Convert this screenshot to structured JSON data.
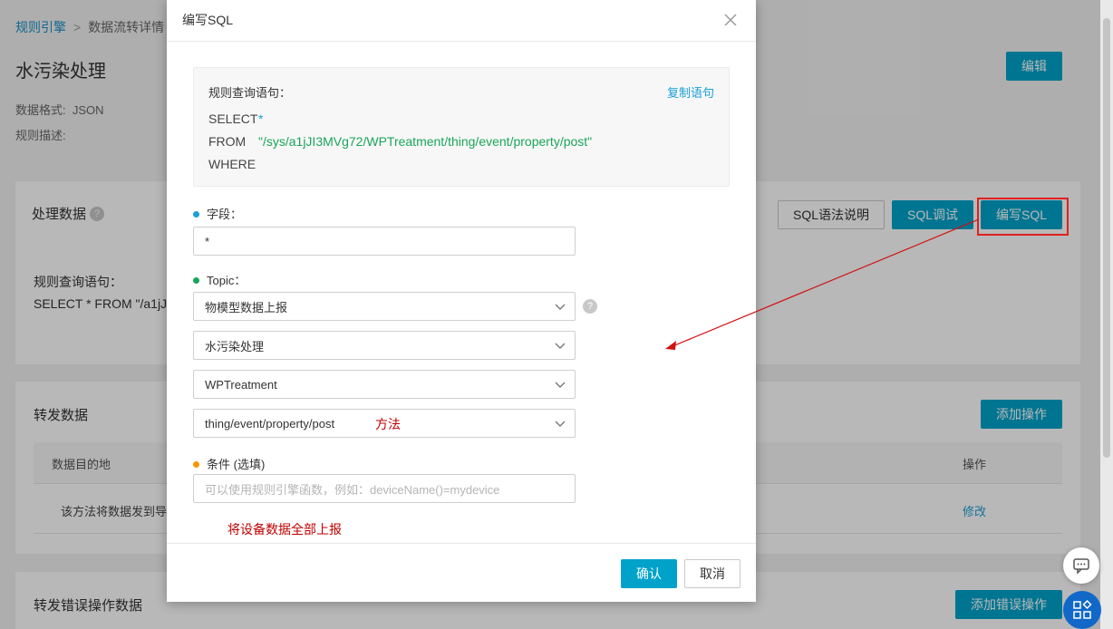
{
  "breadcrumb": {
    "root": "规则引擎",
    "current": "数据流转详情"
  },
  "page": {
    "title": "水污染处理",
    "data_format_label": "数据格式:",
    "data_format_value": "JSON",
    "desc_label": "规则描述:",
    "edit_button": "编辑"
  },
  "process_card": {
    "title": "处理数据",
    "help_glyph": "?",
    "sql_help_button": "SQL语法说明",
    "sql_debug_button": "SQL调试",
    "write_sql_button": "编写SQL",
    "query_label": "规则查询语句：",
    "query_value": "SELECT * FROM \"/a1jJ"
  },
  "forward_card": {
    "title": "转发数据",
    "add_button": "添加操作",
    "col_target": "数据目的地",
    "col_action": "操作",
    "row_target": "该方法将数据发到导",
    "row_action": "修改"
  },
  "error_card": {
    "title": "转发错误操作数据",
    "add_button": "添加错误操作"
  },
  "modal": {
    "title": "编写SQL",
    "query_label": "规则查询语句：",
    "copy_link": "复制语句",
    "sql_select_kw": "SELECT",
    "sql_select_val": "*",
    "sql_from_kw": "FROM",
    "sql_from_val": "\"/sys/a1jJI3MVg72/WPTreatment/thing/event/property/post\"",
    "sql_where_kw": "WHERE",
    "field_label": "字段：",
    "field_value": "*",
    "topic_label": "Topic：",
    "topic_help": "?",
    "topic_selects": [
      "物模型数据上报",
      "水污染处理",
      "WPTreatment",
      "thing/event/property/post"
    ],
    "condition_label": "条件 (选填)",
    "condition_placeholder": "可以使用规则引擎函数，例如：deviceName()=mydevice",
    "confirm_button": "确认",
    "cancel_button": "取消"
  },
  "annotations": {
    "method": "方法",
    "upload_all": "将设备数据全部上报"
  },
  "colors": {
    "primary": "#00a2ca",
    "link": "#1a9fd6",
    "sql_highlight": "#1aa55a",
    "annotation": "#c00000",
    "dot_field": "#1a9fd6",
    "dot_topic": "#1aa55a",
    "dot_condition": "#f39800"
  },
  "icons": {
    "close": "close-icon",
    "chevron": "chevron-down-icon",
    "help": "help-icon",
    "chat": "chat-icon",
    "apps": "apps-grid-icon"
  }
}
